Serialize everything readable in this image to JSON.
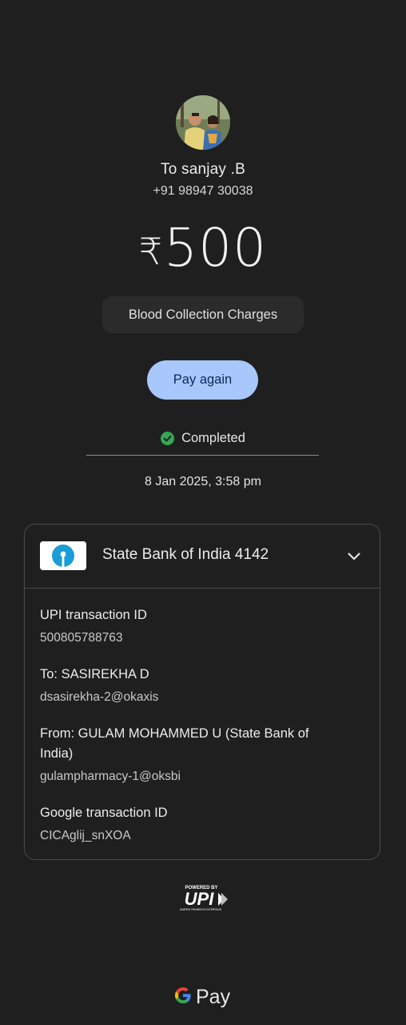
{
  "recipient": {
    "name": "To sanjay .B",
    "phone": "+91 98947 30038"
  },
  "payment": {
    "currency_symbol": "₹",
    "amount": "500",
    "note": "Blood Collection Charges",
    "pay_again_label": "Pay again",
    "status": "Completed",
    "datetime": "8 Jan 2025, 3:58 pm"
  },
  "bank": {
    "name": "State Bank of India 4142"
  },
  "details": [
    {
      "label": "UPI transaction ID",
      "value": "500805788763"
    },
    {
      "label": "To: SASIREKHA D",
      "value": "dsasirekha-2@okaxis"
    },
    {
      "label": "From: GULAM MOHAMMED  U (State Bank of India)",
      "value": "gulampharmacy-1@oksbi"
    },
    {
      "label": "Google transaction ID",
      "value": "CICAglij_snXOA"
    }
  ],
  "footer": {
    "upi_powered_by": "POWERED BY",
    "upi_mark": "UPI",
    "upi_tagline": "UNIFIED PAYMENTS INTERFACE",
    "gpay_text": "Pay"
  },
  "colors": {
    "background": "#1f1f1f",
    "accent_button": "#a8c7fa",
    "success_green": "#34a853",
    "sbi_blue": "#1a9cd8"
  },
  "icons": {
    "status": "check-circle-icon",
    "expand": "chevron-down-icon",
    "bank": "sbi-logo-icon",
    "brand": "google-g-icon"
  }
}
